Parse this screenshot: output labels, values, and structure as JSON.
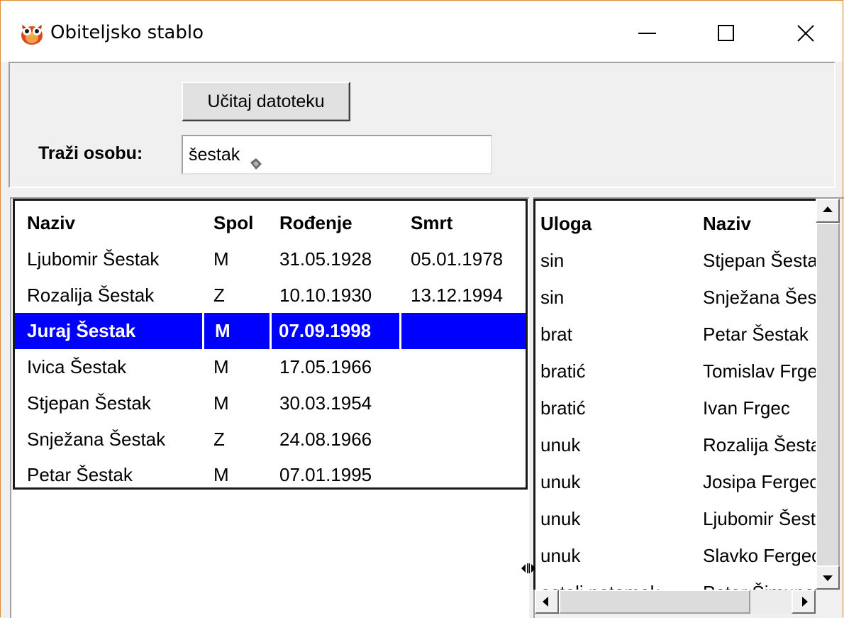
{
  "window": {
    "title": "Obiteljsko stablo",
    "icon": "owl-icon",
    "controls": [
      "minimize-icon",
      "maximize-icon",
      "close-icon"
    ]
  },
  "toolbar": {
    "load_label": "Učitaj datoteku",
    "search_label": "Traži osobu:",
    "search_value": "šestak"
  },
  "persons": {
    "columns": [
      "Naziv",
      "Spol",
      "Rođenje",
      "Smrt"
    ],
    "selected_index": 2,
    "rows": [
      [
        "Ljubomir Šestak",
        "M",
        "31.05.1928",
        "05.01.1978"
      ],
      [
        "Rozalija Šestak",
        "Z",
        "10.10.1930",
        "13.12.1994"
      ],
      [
        "Juraj Šestak",
        "M",
        "07.09.1998",
        ""
      ],
      [
        "Ivica Šestak",
        "M",
        "17.05.1966",
        ""
      ],
      [
        "Stjepan Šestak",
        "M",
        "30.03.1954",
        ""
      ],
      [
        "Snježana Šestak",
        "Z",
        "24.08.1966",
        ""
      ],
      [
        "Petar Šestak",
        "M",
        "07.01.1995",
        ""
      ]
    ]
  },
  "relations": {
    "columns": [
      "Uloga",
      "Naziv"
    ],
    "rows": [
      [
        "sin",
        "Stjepan Šestak"
      ],
      [
        "sin",
        "Snježana Šestak"
      ],
      [
        "brat",
        "Petar Šestak"
      ],
      [
        "bratić",
        "Tomislav Frgec"
      ],
      [
        "bratić",
        "Ivan Frgec"
      ],
      [
        "unuk",
        "Rozalija Šestak"
      ],
      [
        "unuk",
        "Josipa Fergec"
      ],
      [
        "unuk",
        "Ljubomir Šestak"
      ],
      [
        "unuk",
        "Slavko Fergec"
      ],
      [
        "ostali potomak",
        "Petar Šimunović"
      ]
    ]
  }
}
